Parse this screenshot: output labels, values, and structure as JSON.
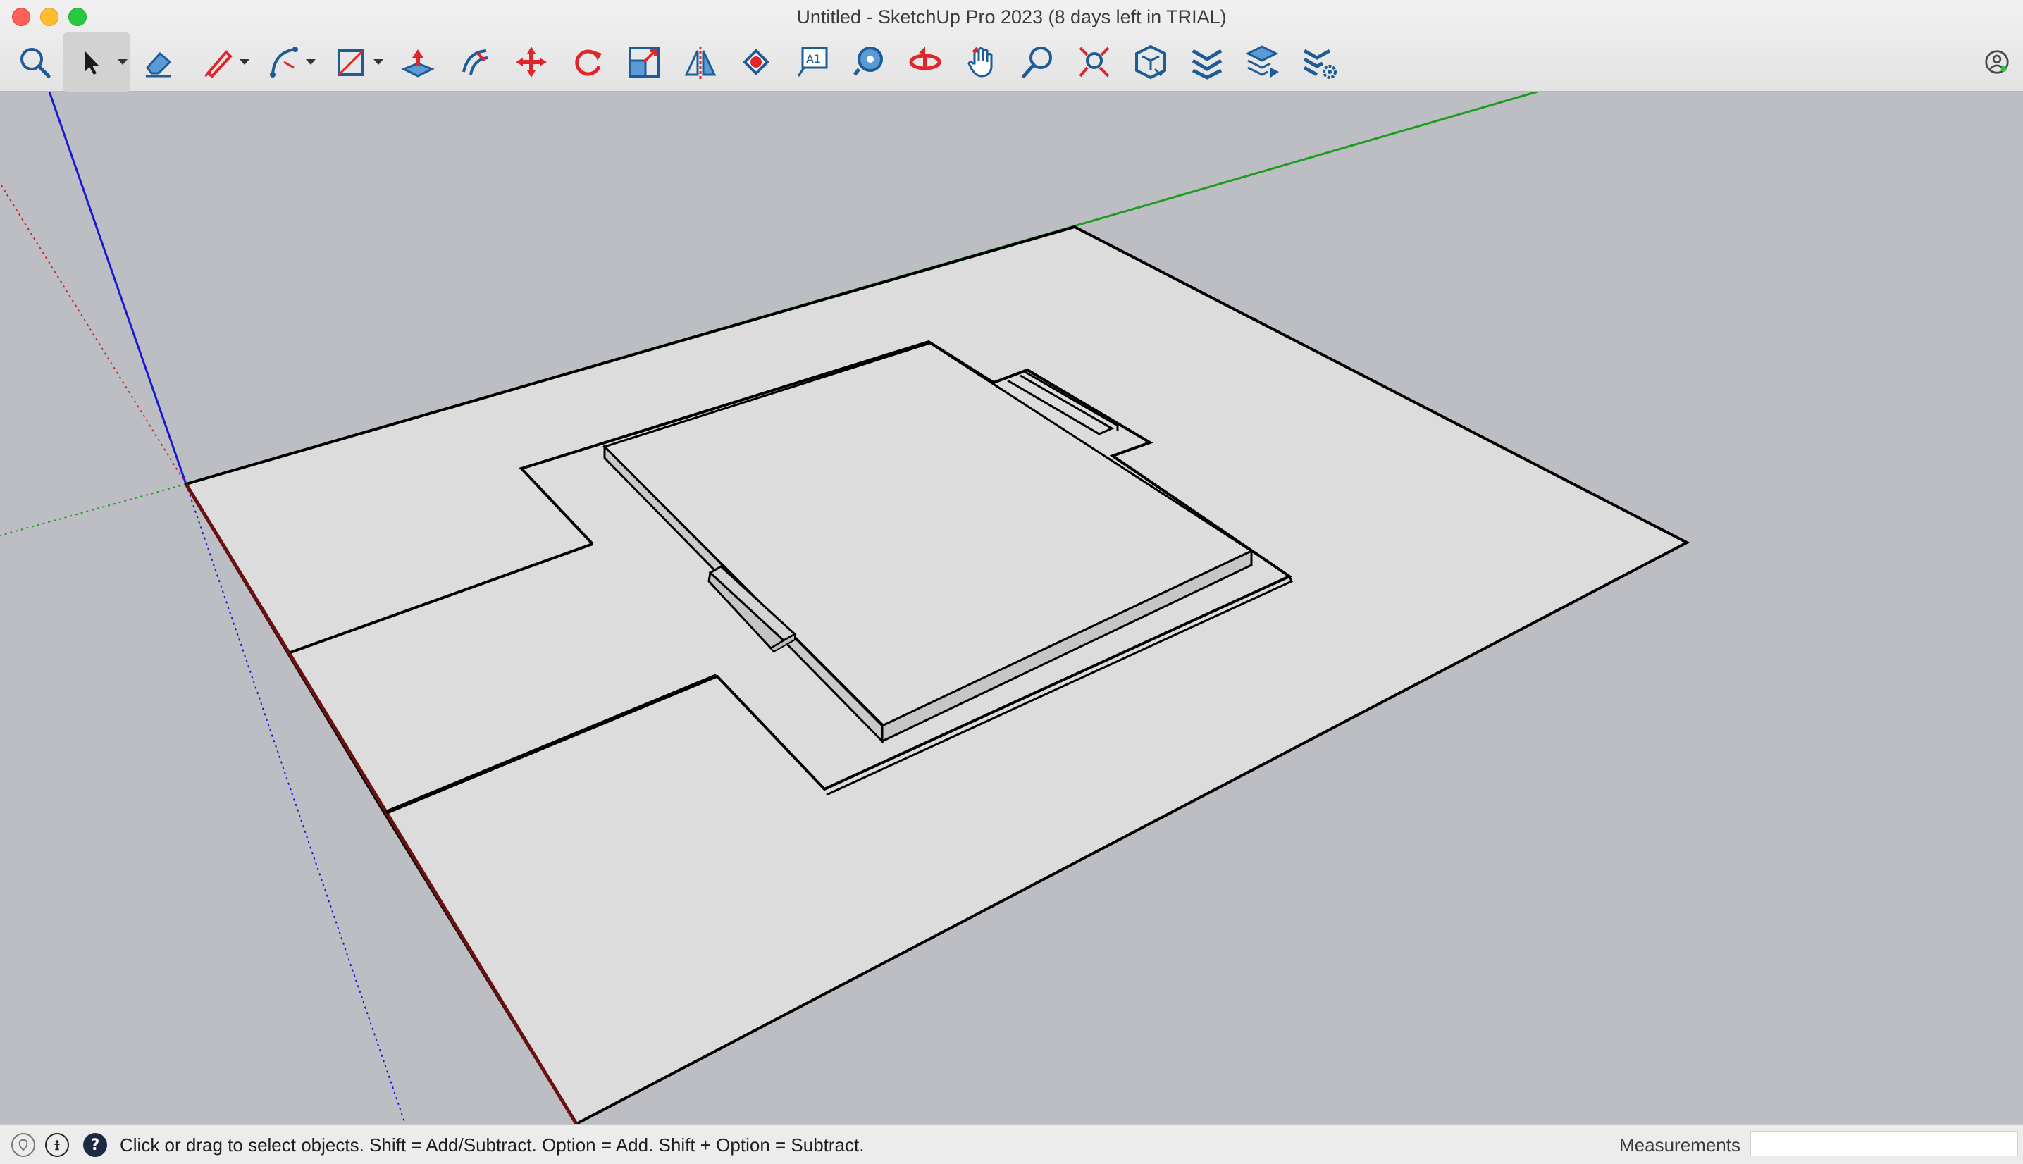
{
  "window": {
    "title": "Untitled - SketchUp Pro 2023 (8 days left in TRIAL)"
  },
  "toolbar": {
    "tools": [
      {
        "name": "search",
        "icon": "search-icon"
      },
      {
        "name": "select",
        "icon": "arrow-cursor-icon",
        "active": true,
        "has_dropdown": true
      },
      {
        "name": "eraser",
        "icon": "eraser-icon"
      },
      {
        "name": "line",
        "icon": "pencil-icon",
        "has_dropdown": true
      },
      {
        "name": "arc",
        "icon": "arc-icon",
        "has_dropdown": true
      },
      {
        "name": "rectangle",
        "icon": "rectangle-icon",
        "has_dropdown": true
      },
      {
        "name": "push-pull",
        "icon": "push-pull-icon"
      },
      {
        "name": "offset",
        "icon": "offset-icon"
      },
      {
        "name": "move",
        "icon": "move-icon"
      },
      {
        "name": "rotate",
        "icon": "rotate-icon"
      },
      {
        "name": "scale",
        "icon": "scale-icon"
      },
      {
        "name": "flip",
        "icon": "flip-icon"
      },
      {
        "name": "paint-bucket",
        "icon": "paint-bucket-icon"
      },
      {
        "name": "text",
        "icon": "text-label-icon"
      },
      {
        "name": "tape-measure",
        "icon": "tape-measure-icon"
      },
      {
        "name": "orbit",
        "icon": "orbit-icon"
      },
      {
        "name": "pan",
        "icon": "pan-hand-icon"
      },
      {
        "name": "zoom",
        "icon": "zoom-magnifier-icon"
      },
      {
        "name": "zoom-extents",
        "icon": "zoom-extents-icon"
      },
      {
        "name": "3d-warehouse",
        "icon": "warehouse-icon"
      },
      {
        "name": "extension-warehouse",
        "icon": "extension-warehouse-icon"
      },
      {
        "name": "send-to-layout",
        "icon": "send-to-layout-icon"
      },
      {
        "name": "extension-manager",
        "icon": "extension-manager-icon"
      }
    ],
    "account_icon": "account-icon"
  },
  "status": {
    "hint": "Click or drag to select objects. Shift = Add/Subtract. Option = Add. Shift + Option = Subtract.",
    "measurements_label": "Measurements",
    "measurements_value": ""
  },
  "colors": {
    "viewport_bg": "#bcbec3",
    "face_fill": "#dcdcdc",
    "edge": "#000000",
    "axis_red": "#c42b2b",
    "axis_green": "#1f9c1f",
    "axis_blue": "#1a1ad0",
    "tool_blue": "#1e5c96",
    "tool_red": "#e0262b"
  }
}
